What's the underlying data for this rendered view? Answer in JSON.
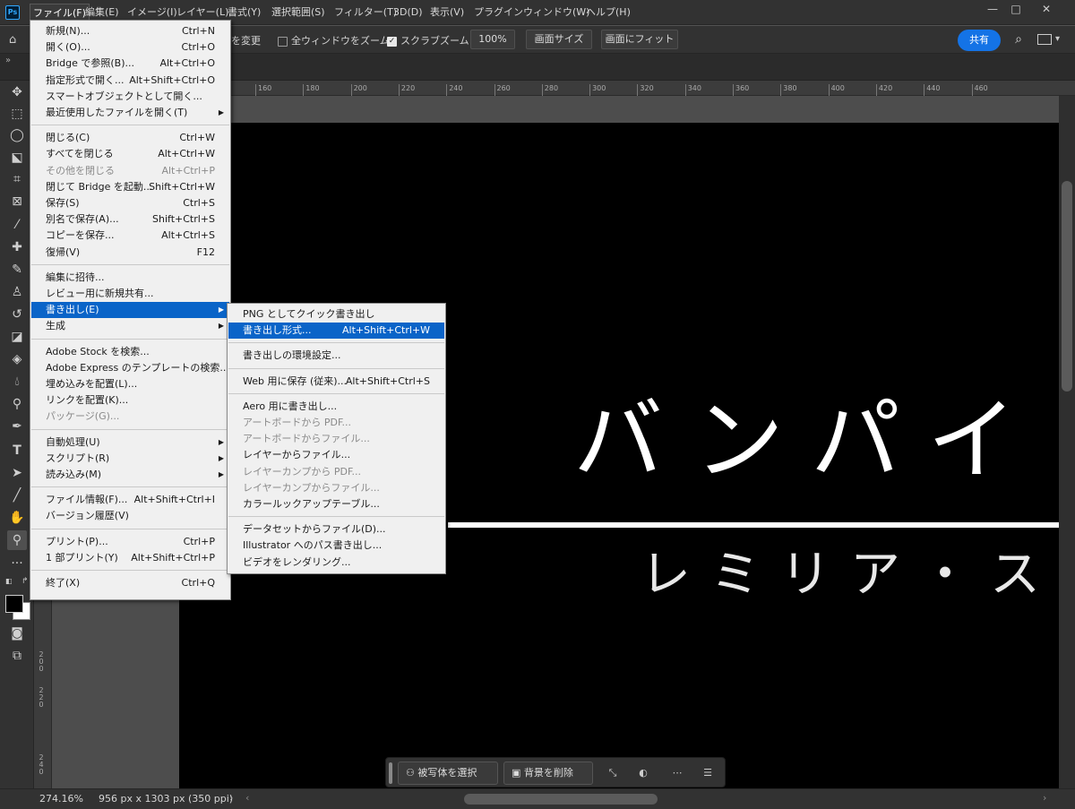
{
  "app": {
    "logo": "Ps"
  },
  "menubar": {
    "items": [
      "ファイル(F)",
      "編集(E)",
      "イメージ(I)",
      "レイヤー(L)",
      "書式(Y)",
      "選択範囲(S)",
      "フィルター(T)",
      "3D(D)",
      "表示(V)",
      "プラグイン",
      "ウィンドウ(W)",
      "ヘルプ(H)"
    ],
    "window_controls": [
      "—",
      "□",
      "✕"
    ]
  },
  "options": {
    "resize_label": "を変更",
    "zoom_all_label": "全ウィンドウをズーム",
    "scrubby_label": "スクラブズーム",
    "zoom_value": "100%",
    "fit_screen": "画面サイズ",
    "fill_screen": "画面にフィット",
    "share": "共有"
  },
  "ruler": {
    "h_ticks": [
      "160",
      "180",
      "200",
      "220",
      "240",
      "260",
      "280",
      "300",
      "320",
      "340",
      "360",
      "380",
      "400",
      "420",
      "440",
      "460"
    ],
    "v_ticks": [
      {
        "label": "2\n0\n0"
      },
      {
        "label": "2\n2\n0"
      },
      {
        "label": "2\n4\n0"
      }
    ]
  },
  "document": {
    "title_text": "バンパイ",
    "subtitle_text": "レミリア・ス"
  },
  "taskbar": {
    "select_subject": "被写体を選択",
    "remove_bg": "背景を削除"
  },
  "status": {
    "zoom": "274.16%",
    "doc_info": "956 px x 1303 px (350 ppi)"
  },
  "file_menu": [
    {
      "label": "新規(N)...",
      "shortcut": "Ctrl+N"
    },
    {
      "label": "開く(O)...",
      "shortcut": "Ctrl+O"
    },
    {
      "label": "Bridge で参照(B)...",
      "shortcut": "Alt+Ctrl+O"
    },
    {
      "label": "指定形式で開く...",
      "shortcut": "Alt+Shift+Ctrl+O"
    },
    {
      "label": "スマートオブジェクトとして開く...",
      "shortcut": ""
    },
    {
      "label": "最近使用したファイルを開く(T)",
      "shortcut": "",
      "submenu": true
    },
    {
      "sep": true
    },
    {
      "label": "閉じる(C)",
      "shortcut": "Ctrl+W"
    },
    {
      "label": "すべてを閉じる",
      "shortcut": "Alt+Ctrl+W"
    },
    {
      "label": "その他を閉じる",
      "shortcut": "Alt+Ctrl+P",
      "disabled": true
    },
    {
      "label": "閉じて Bridge を起動...",
      "shortcut": "Shift+Ctrl+W"
    },
    {
      "label": "保存(S)",
      "shortcut": "Ctrl+S"
    },
    {
      "label": "別名で保存(A)...",
      "shortcut": "Shift+Ctrl+S"
    },
    {
      "label": "コピーを保存...",
      "shortcut": "Alt+Ctrl+S"
    },
    {
      "label": "復帰(V)",
      "shortcut": "F12"
    },
    {
      "sep": true
    },
    {
      "label": "編集に招待...",
      "shortcut": ""
    },
    {
      "label": "レビュー用に新規共有...",
      "shortcut": ""
    },
    {
      "label": "書き出し(E)",
      "shortcut": "",
      "submenu": true,
      "highlighted": true
    },
    {
      "label": "生成",
      "shortcut": "",
      "submenu": true
    },
    {
      "sep": true
    },
    {
      "label": "Adobe Stock を検索...",
      "shortcut": ""
    },
    {
      "label": "Adobe Express のテンプレートの検索...",
      "shortcut": ""
    },
    {
      "label": "埋め込みを配置(L)...",
      "shortcut": ""
    },
    {
      "label": "リンクを配置(K)...",
      "shortcut": ""
    },
    {
      "label": "パッケージ(G)...",
      "shortcut": "",
      "disabled": true
    },
    {
      "sep": true
    },
    {
      "label": "自動処理(U)",
      "shortcut": "",
      "submenu": true
    },
    {
      "label": "スクリプト(R)",
      "shortcut": "",
      "submenu": true
    },
    {
      "label": "読み込み(M)",
      "shortcut": "",
      "submenu": true
    },
    {
      "sep": true
    },
    {
      "label": "ファイル情報(F)...",
      "shortcut": "Alt+Shift+Ctrl+I"
    },
    {
      "label": "バージョン履歴(V)",
      "shortcut": ""
    },
    {
      "sep": true
    },
    {
      "label": "プリント(P)...",
      "shortcut": "Ctrl+P"
    },
    {
      "label": "1 部プリント(Y)",
      "shortcut": "Alt+Shift+Ctrl+P"
    },
    {
      "sep": true
    },
    {
      "label": "終了(X)",
      "shortcut": "Ctrl+Q"
    }
  ],
  "export_menu": [
    {
      "label": "PNG としてクイック書き出し",
      "shortcut": ""
    },
    {
      "label": "書き出し形式...",
      "shortcut": "Alt+Shift+Ctrl+W",
      "highlighted": true
    },
    {
      "sep": true
    },
    {
      "label": "書き出しの環境設定...",
      "shortcut": ""
    },
    {
      "sep": true
    },
    {
      "label": "Web 用に保存 (従来)...",
      "shortcut": "Alt+Shift+Ctrl+S"
    },
    {
      "sep": true
    },
    {
      "label": "Aero 用に書き出し...",
      "shortcut": ""
    },
    {
      "label": "アートボードから PDF...",
      "shortcut": "",
      "disabled": true
    },
    {
      "label": "アートボードからファイル...",
      "shortcut": "",
      "disabled": true
    },
    {
      "label": "レイヤーからファイル...",
      "shortcut": ""
    },
    {
      "label": "レイヤーカンプから PDF...",
      "shortcut": "",
      "disabled": true
    },
    {
      "label": "レイヤーカンプからファイル...",
      "shortcut": "",
      "disabled": true
    },
    {
      "label": "カラールックアップテーブル...",
      "shortcut": ""
    },
    {
      "sep": true
    },
    {
      "label": "データセットからファイル(D)...",
      "shortcut": ""
    },
    {
      "label": "Illustrator へのパス書き出し...",
      "shortcut": ""
    },
    {
      "label": "ビデオをレンダリング...",
      "shortcut": ""
    }
  ],
  "colors": {
    "accent": "#0a64c8",
    "share": "#1473e6",
    "menu_bg": "#f0f0f0"
  }
}
